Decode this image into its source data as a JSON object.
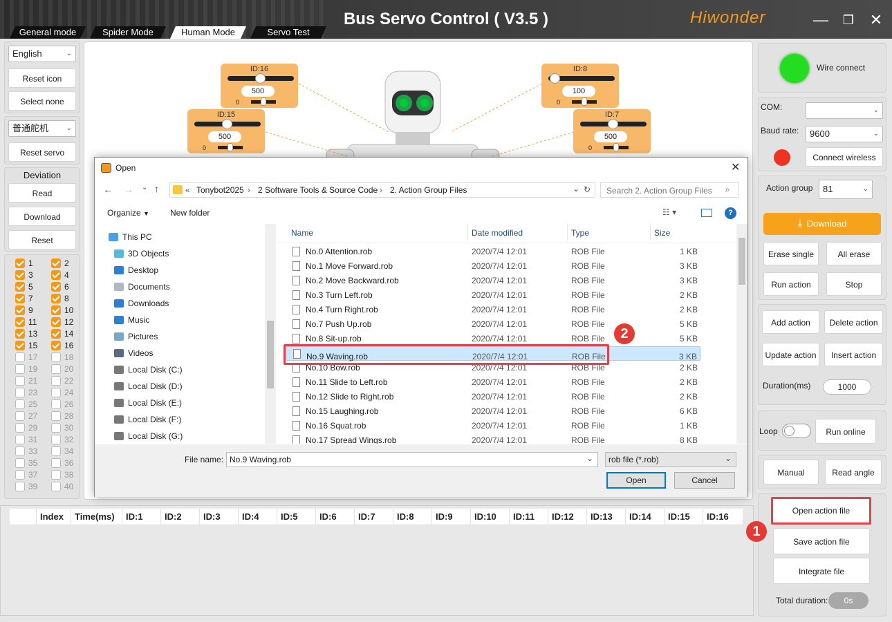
{
  "app": {
    "title": "Bus Servo Control ( V3.5 )",
    "brand": "Hiwonder",
    "mode_tabs": [
      "General mode",
      "Spider Mode",
      "Human Mode",
      "Servo Test"
    ],
    "active_tab": "Human Mode"
  },
  "left": {
    "language": "English",
    "reset_icon": "Reset icon",
    "select_none": "Select none",
    "servo_type": "普通舵机",
    "reset_servo": "Reset servo",
    "deviation_title": "Deviation",
    "read": "Read",
    "download": "Download",
    "reset": "Reset",
    "checkboxes": [
      {
        "label": "1",
        "checked": true
      },
      {
        "label": "2",
        "checked": true
      },
      {
        "label": "3",
        "checked": true
      },
      {
        "label": "4",
        "checked": true
      },
      {
        "label": "5",
        "checked": true
      },
      {
        "label": "6",
        "checked": true
      },
      {
        "label": "7",
        "checked": true
      },
      {
        "label": "8",
        "checked": true
      },
      {
        "label": "9",
        "checked": true
      },
      {
        "label": "10",
        "checked": true
      },
      {
        "label": "11",
        "checked": true
      },
      {
        "label": "12",
        "checked": true
      },
      {
        "label": "13",
        "checked": true
      },
      {
        "label": "14",
        "checked": true
      },
      {
        "label": "15",
        "checked": true
      },
      {
        "label": "16",
        "checked": true
      },
      {
        "label": "17",
        "checked": false
      },
      {
        "label": "18",
        "checked": false
      },
      {
        "label": "19",
        "checked": false
      },
      {
        "label": "20",
        "checked": false
      },
      {
        "label": "21",
        "checked": false
      },
      {
        "label": "22",
        "checked": false
      },
      {
        "label": "23",
        "checked": false
      },
      {
        "label": "24",
        "checked": false
      },
      {
        "label": "25",
        "checked": false
      },
      {
        "label": "26",
        "checked": false
      },
      {
        "label": "27",
        "checked": false
      },
      {
        "label": "28",
        "checked": false
      },
      {
        "label": "29",
        "checked": false
      },
      {
        "label": "30",
        "checked": false
      },
      {
        "label": "31",
        "checked": false
      },
      {
        "label": "32",
        "checked": false
      },
      {
        "label": "33",
        "checked": false
      },
      {
        "label": "34",
        "checked": false
      },
      {
        "label": "35",
        "checked": false
      },
      {
        "label": "36",
        "checked": false
      },
      {
        "label": "37",
        "checked": false
      },
      {
        "label": "38",
        "checked": false
      },
      {
        "label": "39",
        "checked": false
      },
      {
        "label": "40",
        "checked": false
      }
    ]
  },
  "servos": [
    {
      "id": "ID:16",
      "value": "500",
      "zero": "0",
      "position": 0.5
    },
    {
      "id": "ID:15",
      "value": "500",
      "zero": "0",
      "position": 0.5
    },
    {
      "id": "ID:8",
      "value": "100",
      "zero": "0",
      "position": 0.1
    },
    {
      "id": "ID:7",
      "value": "500",
      "zero": "0",
      "position": 0.5
    }
  ],
  "table": {
    "headers": [
      "Index",
      "Time(ms)",
      "ID:1",
      "ID:2",
      "ID:3",
      "ID:4",
      "ID:5",
      "ID:6",
      "ID:7",
      "ID:8",
      "ID:9",
      "ID:10",
      "ID:11",
      "ID:12",
      "ID:13",
      "ID:14",
      "ID:15",
      "ID:16"
    ]
  },
  "right": {
    "wire_connect": "Wire connect",
    "com_label": "COM:",
    "com_value": "",
    "baud_label": "Baud rate:",
    "baud_value": "9600",
    "connect_wireless": "Connect wireless",
    "action_group_label": "Action group",
    "action_group_value": "81",
    "download": "Download",
    "erase_single": "Erase single",
    "all_erase": "All erase",
    "run_action": "Run action",
    "stop": "Stop",
    "add_action": "Add action",
    "delete_action": "Delete action",
    "update_action": "Update action",
    "insert_action": "Insert action",
    "duration_label": "Duration(ms)",
    "duration_value": "1000",
    "loop_label": "Loop",
    "run_online": "Run online",
    "manual": "Manual",
    "read_angle": "Read angle",
    "open_action_file": "Open action file",
    "save_action_file": "Save action file",
    "integrate_file": "Integrate file",
    "total_duration_label": "Total duration:",
    "total_duration_value": "0s",
    "colors": {
      "accent": "#f7a21b",
      "connected": "#22dd22",
      "wireless": "#ee3322"
    }
  },
  "dialog": {
    "title": "Open",
    "path": [
      "Tonybot2025",
      "2 Software Tools & Source Code",
      "2. Action Group Files"
    ],
    "search_placeholder": "Search 2. Action Group Files",
    "organize": "Organize",
    "new_folder": "New folder",
    "columns": {
      "name": "Name",
      "date": "Date modified",
      "type": "Type",
      "size": "Size"
    },
    "tree": [
      {
        "label": "This PC",
        "icon": "computer-icon"
      },
      {
        "label": "3D Objects",
        "icon": "3d-objects-icon"
      },
      {
        "label": "Desktop",
        "icon": "desktop-icon"
      },
      {
        "label": "Documents",
        "icon": "documents-icon"
      },
      {
        "label": "Downloads",
        "icon": "downloads-icon"
      },
      {
        "label": "Music",
        "icon": "music-icon"
      },
      {
        "label": "Pictures",
        "icon": "pictures-icon"
      },
      {
        "label": "Videos",
        "icon": "videos-icon"
      },
      {
        "label": "Local Disk (C:)",
        "icon": "drive-icon"
      },
      {
        "label": "Local Disk (D:)",
        "icon": "drive-icon"
      },
      {
        "label": "Local Disk (E:)",
        "icon": "drive-icon"
      },
      {
        "label": "Local Disk (F:)",
        "icon": "drive-icon"
      },
      {
        "label": "Local Disk (G:)",
        "icon": "drive-icon"
      }
    ],
    "files": [
      {
        "name": "No.0 Attention.rob",
        "date": "2020/7/4 12:01",
        "type": "ROB File",
        "size": "1 KB"
      },
      {
        "name": "No.1 Move Forward.rob",
        "date": "2020/7/4 12:01",
        "type": "ROB File",
        "size": "3 KB"
      },
      {
        "name": "No.2 Move Backward.rob",
        "date": "2020/7/4 12:01",
        "type": "ROB File",
        "size": "3 KB"
      },
      {
        "name": "No.3 Turn Left.rob",
        "date": "2020/7/4 12:01",
        "type": "ROB File",
        "size": "2 KB"
      },
      {
        "name": "No.4 Turn Right.rob",
        "date": "2020/7/4 12:01",
        "type": "ROB File",
        "size": "2 KB"
      },
      {
        "name": "No.7 Push Up.rob",
        "date": "2020/7/4 12:01",
        "type": "ROB File",
        "size": "5 KB"
      },
      {
        "name": "No.8 Sit-up.rob",
        "date": "2020/7/4 12:01",
        "type": "ROB File",
        "size": "5 KB"
      },
      {
        "name": "No.9 Waving.rob",
        "date": "2020/7/4 12:01",
        "type": "ROB File",
        "size": "3 KB",
        "selected": true
      },
      {
        "name": "No.10 Bow.rob",
        "date": "2020/7/4 12:01",
        "type": "ROB File",
        "size": "2 KB"
      },
      {
        "name": "No.11 Slide to Left.rob",
        "date": "2020/7/4 12:01",
        "type": "ROB File",
        "size": "2 KB"
      },
      {
        "name": "No.12 Slide to Right.rob",
        "date": "2020/7/4 12:01",
        "type": "ROB File",
        "size": "2 KB"
      },
      {
        "name": "No.15 Laughing.rob",
        "date": "2020/7/4 12:01",
        "type": "ROB File",
        "size": "6 KB"
      },
      {
        "name": "No.16 Squat.rob",
        "date": "2020/7/4 12:01",
        "type": "ROB File",
        "size": "1 KB"
      },
      {
        "name": "No.17 Spread Wings.rob",
        "date": "2020/7/4 12:01",
        "type": "ROB File",
        "size": "8 KB"
      }
    ],
    "file_name_label": "File name:",
    "file_name_value": "No.9 Waving.rob",
    "file_type_value": "rob file (*.rob)",
    "open": "Open",
    "cancel": "Cancel"
  },
  "callouts": {
    "one": "1",
    "two": "2"
  }
}
